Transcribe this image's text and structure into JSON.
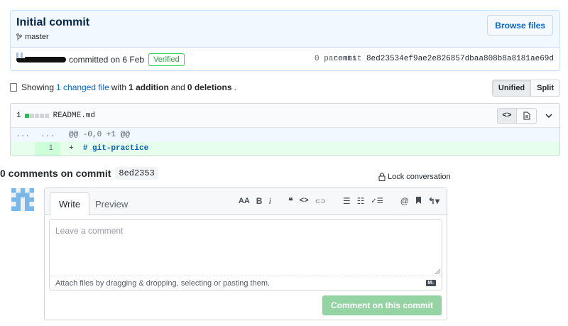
{
  "commit": {
    "title": "Initial commit",
    "branch": "master",
    "browse_label": "Browse files",
    "committed_text": "committed on 6 Feb",
    "verified_label": "Verified",
    "parents_text": "0 parents",
    "commit_label": "commit",
    "sha": "8ed23534ef9ae2e826857dbaa808b8a8181ae69d"
  },
  "summary": {
    "showing": "Showing",
    "changed_files": "1 changed file",
    "with": "with",
    "additions": "1 addition",
    "and": "and",
    "deletions": "0 deletions",
    "period": ".",
    "view_unified": "Unified",
    "view_split": "Split"
  },
  "diff": {
    "count": "1",
    "filename": "README.md",
    "view_code_icon": "code-icon",
    "rich_diff_icon": "file-icon",
    "hunk_left": "...",
    "hunk_right": "...",
    "hunk_header": "@@ -0,0 +1 @@",
    "added_line_number": "1",
    "added_prefix": "+",
    "added_text": "# git-practice"
  },
  "comments": {
    "heading": "0 comments on commit",
    "sha_short": "8ed2353",
    "lock_label": "Lock conversation",
    "tab_write": "Write",
    "tab_preview": "Preview",
    "placeholder": "Leave a comment",
    "attach_text": "Attach files by dragging & dropping, selecting or pasting them.",
    "markdown_badge": "M↓",
    "submit_label": "Comment on this commit",
    "toolbar": {
      "header": "AA",
      "bold": "B",
      "italic": "i",
      "quote": "❝",
      "code": "<>",
      "link": "⊂⊃",
      "ul": "☰",
      "ol": "☷",
      "task": "✓☰",
      "mention": "@",
      "saved": "🔖",
      "reply": "↰▾"
    }
  },
  "colors": {
    "link": "#0366d6",
    "verified": "#28a745",
    "submit_disabled": "#94d3a2",
    "header_bg": "#f1f8ff"
  }
}
